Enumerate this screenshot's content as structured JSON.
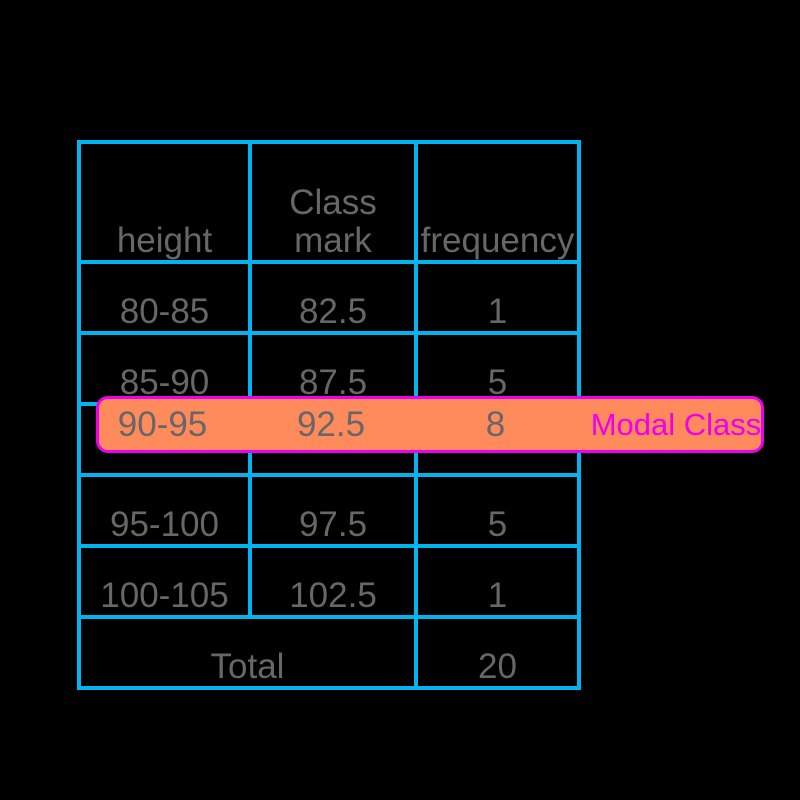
{
  "table": {
    "columns": [
      {
        "key": "height",
        "header": "height"
      },
      {
        "key": "class_mark",
        "header": "Class mark"
      },
      {
        "key": "frequency",
        "header": "frequency"
      }
    ],
    "rows": [
      {
        "height": "80-85",
        "class_mark": "82.5",
        "frequency": "1",
        "modal": false
      },
      {
        "height": "85-90",
        "class_mark": "87.5",
        "frequency": "5",
        "modal": false
      },
      {
        "height": "90-95",
        "class_mark": "92.5",
        "frequency": "8",
        "modal": true
      },
      {
        "height": "95-100",
        "class_mark": "97.5",
        "frequency": "5",
        "modal": false
      },
      {
        "height": "100-105",
        "class_mark": "102.5",
        "frequency": "1",
        "modal": false
      }
    ],
    "total": {
      "label": "Total",
      "value": "20"
    }
  },
  "annotation": {
    "modal_class_label": "Modal Class"
  },
  "colors": {
    "background": "#000000",
    "grid": "#00b4f0",
    "text": "#676767",
    "accent_orange": "#ff8a5c",
    "accent_magenta": "#ee00ee",
    "highlight_fill": "#ff8a5c"
  },
  "chart_data": {
    "type": "table",
    "title": "",
    "columns": [
      "height",
      "Class mark",
      "frequency"
    ],
    "categories": [
      "80-85",
      "85-90",
      "90-95",
      "95-100",
      "100-105"
    ],
    "class_marks": [
      82.5,
      87.5,
      92.5,
      97.5,
      102.5
    ],
    "values": [
      1,
      5,
      8,
      5,
      1
    ],
    "total": 20,
    "modal_class": "90-95",
    "modal_class_index": 2,
    "annotations": [
      "Modal Class",
      "Total"
    ],
    "xlabel": "height",
    "ylabel": "frequency"
  }
}
